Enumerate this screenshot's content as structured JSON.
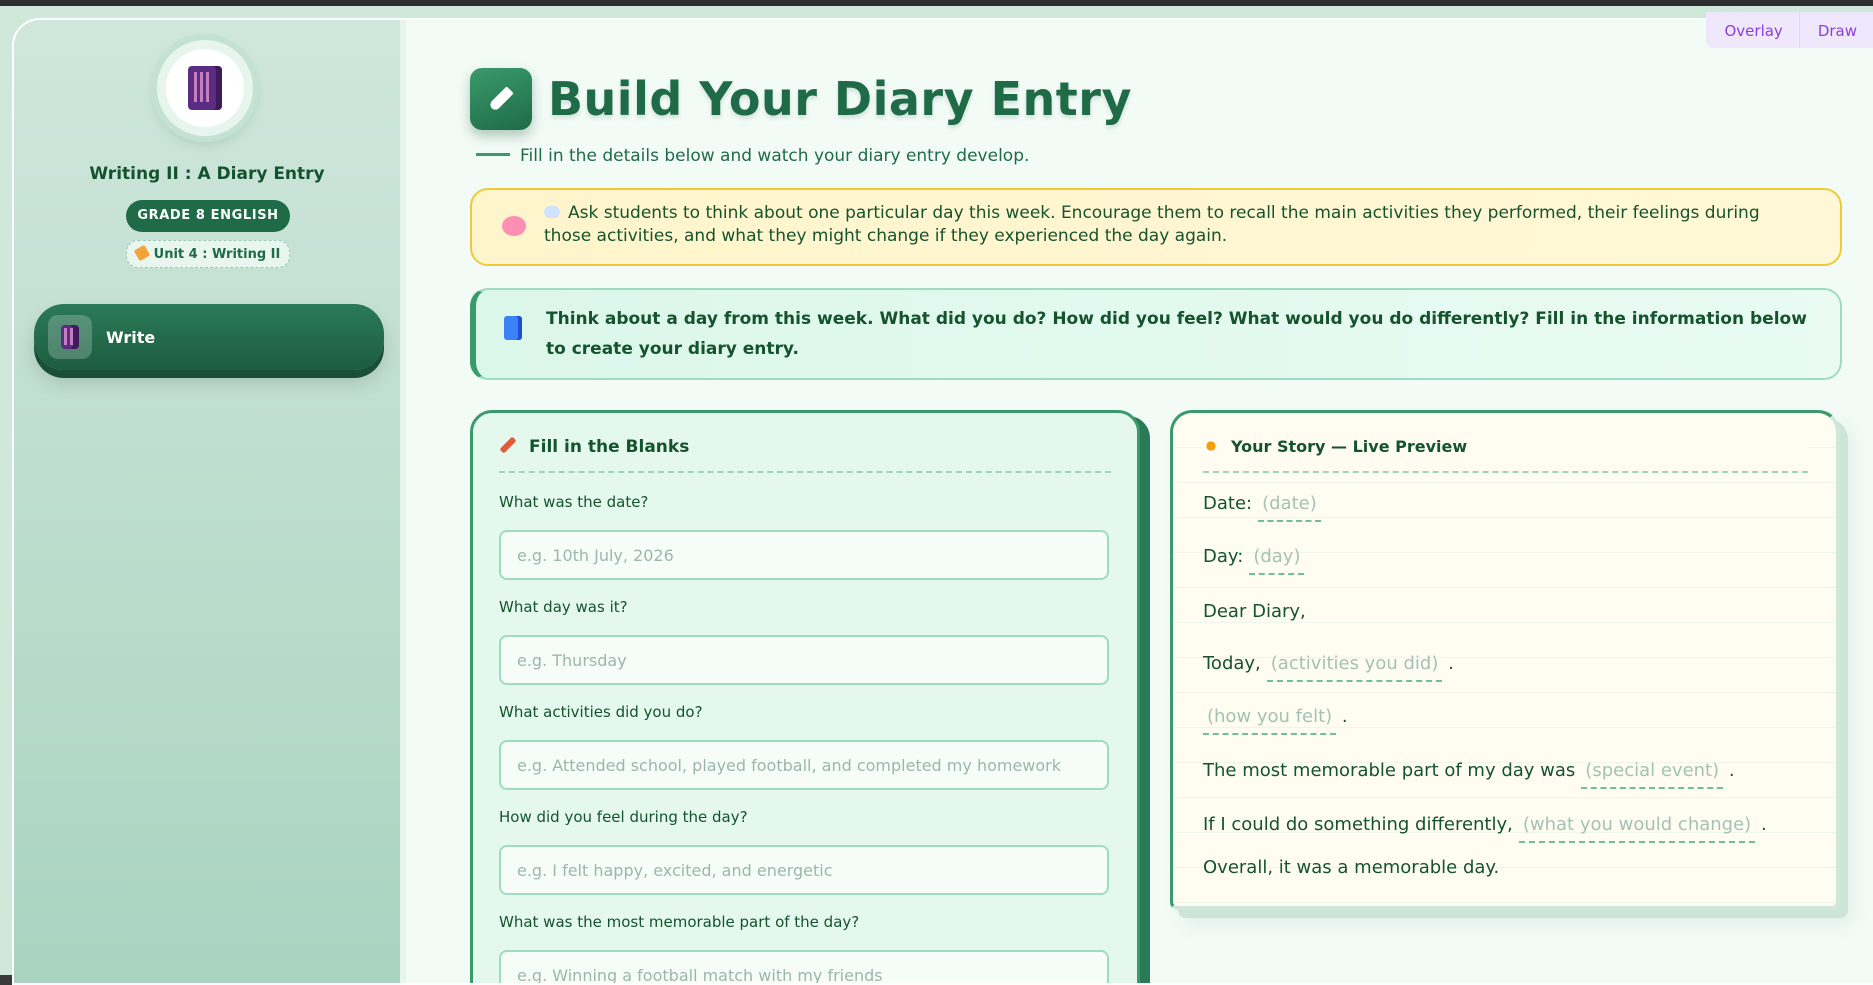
{
  "toolbar": {
    "overlay_label": "Overlay",
    "draw_label": "Draw"
  },
  "sidebar": {
    "course_title": "Writing II : A Diary Entry",
    "grade_badge": "GRADE 8 ENGLISH",
    "unit_badge": "Unit 4 : Writing II",
    "nav_items": [
      {
        "label": "Write",
        "icon": "book-icon",
        "active": true
      }
    ]
  },
  "header": {
    "title": "Build Your Diary Entry",
    "subtitle": "Fill in the details below and watch your diary entry develop."
  },
  "teacher_hint": "Ask students to think about one particular day this week. Encourage them to recall the main activities they performed, their feelings during those activities, and what they might change if they experienced the day again.",
  "prompt": "Think about a day from this week. What did you do? How did you feel? What would you do differently? Fill in the information below to create your diary entry.",
  "form": {
    "heading": "Fill in the Blanks",
    "fields": [
      {
        "label": "What was the date?",
        "placeholder": "e.g. 10th July, 2026",
        "value": ""
      },
      {
        "label": "What day was it?",
        "placeholder": "e.g. Thursday",
        "value": ""
      },
      {
        "label": "What activities did you do?",
        "placeholder": "e.g. Attended school, played football, and completed my homework",
        "value": ""
      },
      {
        "label": "How did you feel during the day?",
        "placeholder": "e.g. I felt happy, excited, and energetic",
        "value": ""
      },
      {
        "label": "What was the most memorable part of the day?",
        "placeholder": "e.g. Winning a football match with my friends",
        "value": ""
      }
    ]
  },
  "preview": {
    "heading": "Your Story — Live Preview",
    "date_label": "Date:",
    "date_ph": "(date)",
    "day_label": "Day:",
    "day_ph": "(day)",
    "greeting": "Dear Diary,",
    "today_label": "Today,",
    "activities_ph": "(activities you did)",
    "feelings_ph": "(how you felt)",
    "memorable_label": "The most memorable part of my day was",
    "memorable_ph": "(special event)",
    "change_label": "If I could do something differently,",
    "change_ph": "(what you would change)",
    "period": ".",
    "closing": "Overall, it was a memorable day."
  }
}
